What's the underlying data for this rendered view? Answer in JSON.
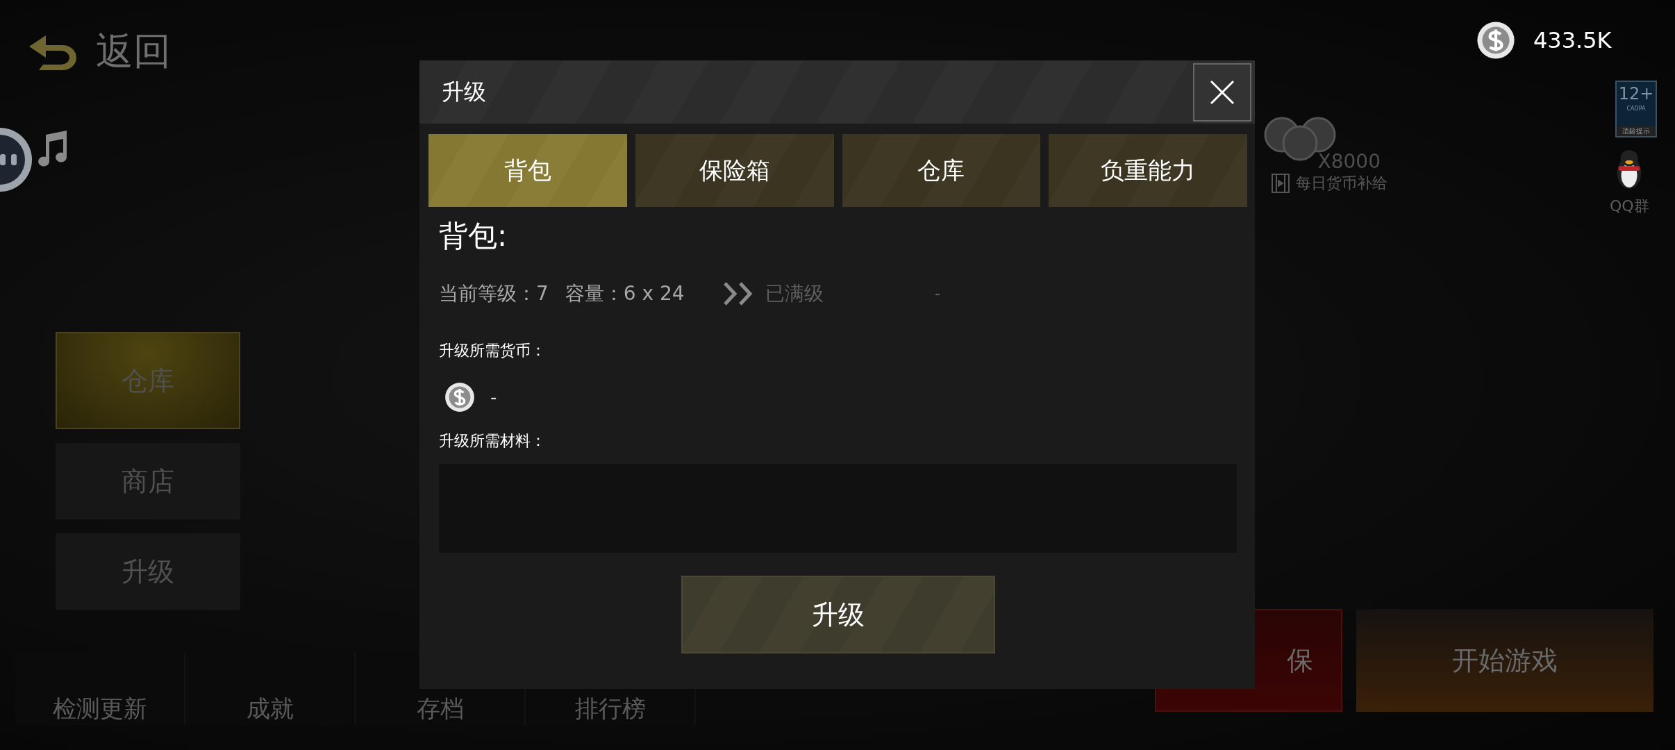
{
  "back": {
    "label": "返回"
  },
  "side_menu": [
    {
      "label": "仓库",
      "selected": true
    },
    {
      "label": "商店",
      "selected": false
    },
    {
      "label": "升级",
      "selected": false
    }
  ],
  "bottom_menu": [
    "检测更新",
    "成就",
    "存档",
    "排行榜"
  ],
  "currency": {
    "amount": "433.5K"
  },
  "daily_reward": {
    "amount": "X8000",
    "label": "每日货币补给"
  },
  "age_badge": {
    "rating": "12+",
    "org": "CADPA",
    "caption": "适龄提示"
  },
  "qq": {
    "label": "QQ群"
  },
  "actions": [
    {
      "label": "保",
      "kind": "insure"
    },
    {
      "label": "开始游戏",
      "kind": "start"
    }
  ],
  "dialog": {
    "title": "升级",
    "tabs": [
      {
        "label": "背包",
        "selected": true
      },
      {
        "label": "保险箱",
        "selected": false
      },
      {
        "label": "仓库",
        "selected": false
      },
      {
        "label": "负重能力",
        "selected": false
      }
    ],
    "heading": "背包:",
    "level_text": "当前等级：7",
    "capacity_text": "容量：6 x 24",
    "next_text": "已满级",
    "next_value": "-",
    "currency_label": "升级所需货币：",
    "currency_cost": "-",
    "materials_label": "升级所需材料：",
    "button": "升级"
  }
}
